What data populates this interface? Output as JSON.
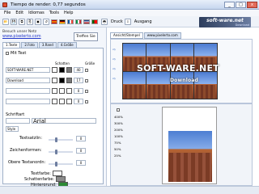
{
  "window": {
    "title": "Tiempo de render: 0,77 segundos",
    "minimize": "_",
    "maximize": "□",
    "close": "x"
  },
  "menu": [
    "File",
    "Edit",
    "Idiomas",
    "Tools",
    "Help"
  ],
  "toolbar": {
    "print_label": "Druck",
    "output_label": "Ausgang"
  },
  "brand": {
    "main": "soft-ware.net",
    "sub": "Download"
  },
  "left_panel": {
    "logo_top": "Besuch unser Netz",
    "logo_link": "www.pixelerto.com",
    "apply_button": "Treffen Sie",
    "tabs": [
      "1.Texte",
      "2.Foto",
      "3.Rand",
      "4.Größe"
    ],
    "section_label": "Mit Text",
    "columns": {
      "shadow": "Schatten",
      "size": "Größe"
    },
    "text_rows": [
      {
        "value": "SOFT-WARE.NET",
        "size": "40"
      },
      {
        "value": "Download",
        "size": "17"
      },
      {
        "value": "",
        "size": "0"
      },
      {
        "value": "",
        "size": "0"
      }
    ],
    "font_label": "Schriftart",
    "font_value": "Arial",
    "style_button": "Style",
    "controls": [
      {
        "label": "Textsatzlin:",
        "value": "0"
      },
      {
        "label": "Zeichenformen:",
        "value": "0"
      },
      {
        "label": "Obere Textanordn:",
        "value": "0"
      }
    ],
    "color_labels": [
      "Textfarbe:",
      "Schattenfarbe:",
      "Hintergrund:"
    ]
  },
  "right": {
    "tabs": [
      "Ansicht/Stempel",
      "www.pixelerto.com"
    ],
    "thumbnail_text_1": "SOFT-WARE.NET",
    "thumbnail_text_2": "Download",
    "zoom_levels": [
      "400%",
      "300%",
      "200%",
      "100%",
      "75%",
      "50%",
      "25%"
    ],
    "preview_text": "SOFT"
  },
  "colors": {
    "accent": "#2d3d5c",
    "link": "#2337c9"
  }
}
